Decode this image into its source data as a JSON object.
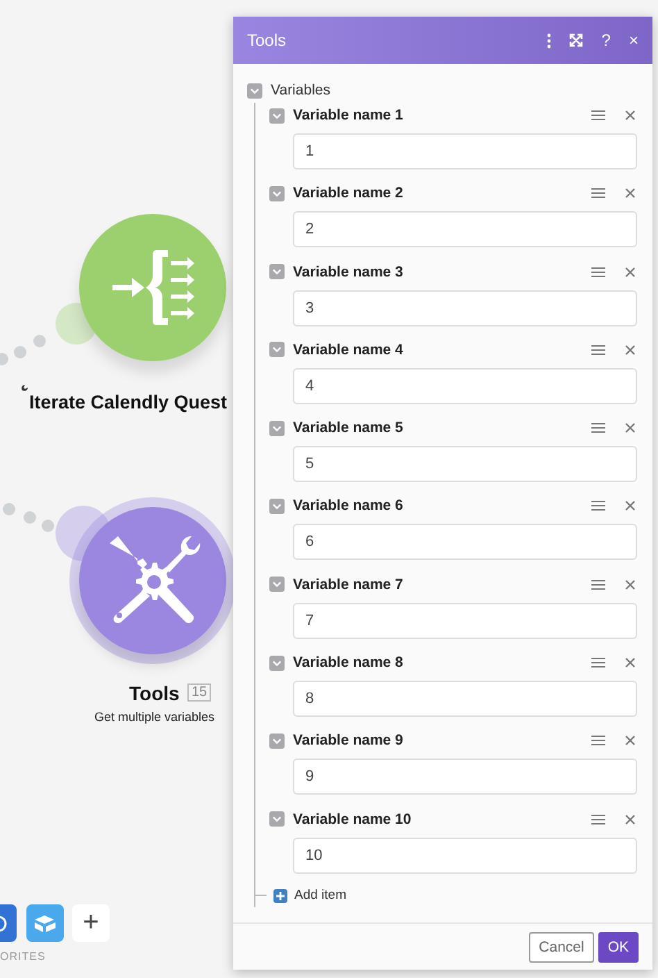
{
  "canvas": {
    "modules": [
      {
        "kind": "iterator",
        "title": "Iterate Calendly Quest",
        "color": "#9cd06f"
      },
      {
        "kind": "tools",
        "title": "Tools",
        "badge": "15",
        "subtitle": "Get multiple variables",
        "color": "#9b87e0"
      }
    ],
    "favorites": {
      "label": "ORITES",
      "add": "+"
    }
  },
  "dialog": {
    "title": "Tools",
    "help": "?",
    "close": "×",
    "section": {
      "label": "Variables",
      "expanded": true,
      "items": [
        {
          "label": "Variable name 1",
          "value": "1",
          "expanded": true
        },
        {
          "label": "Variable name 2",
          "value": "2",
          "expanded": true
        },
        {
          "label": "Variable name 3",
          "value": "3",
          "expanded": true
        },
        {
          "label": "Variable name 4",
          "value": "4",
          "expanded": true
        },
        {
          "label": "Variable name 5",
          "value": "5",
          "expanded": true
        },
        {
          "label": "Variable name 6",
          "value": "6",
          "expanded": true
        },
        {
          "label": "Variable name 7",
          "value": "7",
          "expanded": true
        },
        {
          "label": "Variable name 8",
          "value": "8",
          "expanded": true
        },
        {
          "label": "Variable name 9",
          "value": "9",
          "expanded": true
        },
        {
          "label": "Variable name 10",
          "value": "10",
          "expanded": true
        }
      ],
      "add_label": "Add item"
    },
    "buttons": [
      {
        "kind": "cancel",
        "label": "Cancel"
      },
      {
        "kind": "ok",
        "label": "OK"
      }
    ]
  }
}
